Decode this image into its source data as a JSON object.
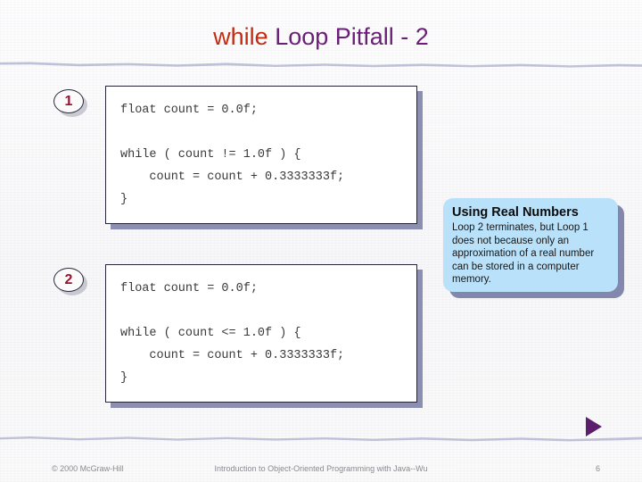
{
  "slide": {
    "title": {
      "keyword": "while",
      "rest": " Loop Pitfall - 2",
      "keyword_color": "#c42b11",
      "rest_color": "#6a2076"
    },
    "badges": [
      {
        "label": "1"
      },
      {
        "label": "2"
      }
    ],
    "code_blocks": [
      {
        "id": "1",
        "code": "float count = 0.0f;\n\nwhile ( count != 1.0f ) {\n    count = count + 0.3333333f;\n}"
      },
      {
        "id": "2",
        "code": "float count = 0.0f;\n\nwhile ( count <= 1.0f ) {\n    count = count + 0.3333333f;\n}"
      }
    ],
    "callout": {
      "heading": "Using Real Numbers",
      "text": "Loop 2 terminates, but Loop 1 does not because only an approximation of a real number can be stored in a computer memory.",
      "background_color": "#b9e2fa",
      "shadow_color": "#8387ae"
    },
    "next_arrow": {
      "icon": "play-triangle-icon",
      "color": "#5c1d6d"
    },
    "footer": {
      "copyright": "© 2000 McGraw-Hill",
      "center": "Introduction to Object-Oriented Programming with Java--Wu",
      "page_number": "6"
    },
    "decor": {
      "band_color": "#b7bad4"
    }
  }
}
